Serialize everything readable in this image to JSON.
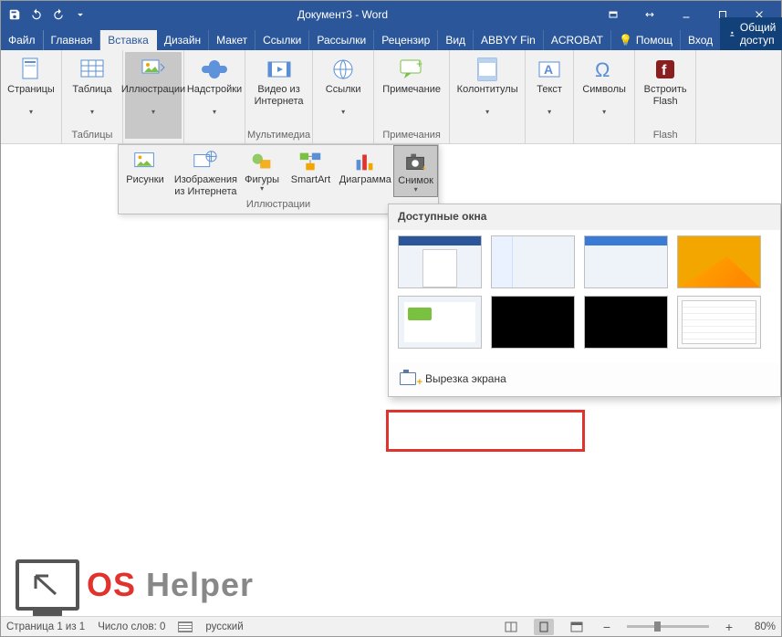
{
  "titlebar": {
    "title": "Документ3 - Word"
  },
  "tabs": {
    "file": "Файл",
    "list": [
      "Главная",
      "Вставка",
      "Дизайн",
      "Макет",
      "Ссылки",
      "Рассылки",
      "Рецензир",
      "Вид",
      "ABBYY Fin",
      "ACROBAT"
    ],
    "active_index": 1,
    "tell_me": "Помощ",
    "sign_in": "Вход",
    "share": "Общий доступ"
  },
  "ribbon": {
    "groups": [
      {
        "name": "pages",
        "caption": "",
        "buttons": [
          {
            "id": "pages",
            "label": "Страницы",
            "drop": true
          }
        ]
      },
      {
        "name": "tables",
        "caption": "Таблицы",
        "buttons": [
          {
            "id": "table",
            "label": "Таблица",
            "drop": true
          }
        ]
      },
      {
        "name": "illustr",
        "caption": "",
        "buttons": [
          {
            "id": "illustrations",
            "label": "Иллюстрации",
            "drop": true,
            "selected": true
          }
        ]
      },
      {
        "name": "addins",
        "caption": "",
        "buttons": [
          {
            "id": "addins",
            "label": "Надстройки",
            "drop": true
          }
        ]
      },
      {
        "name": "media",
        "caption": "Мультимедиа",
        "buttons": [
          {
            "id": "online-video",
            "label": "Видео из Интернета"
          }
        ]
      },
      {
        "name": "links",
        "caption": "",
        "buttons": [
          {
            "id": "links",
            "label": "Ссылки",
            "drop": true
          }
        ]
      },
      {
        "name": "comments",
        "caption": "Примечания",
        "buttons": [
          {
            "id": "comment",
            "label": "Примечание"
          }
        ]
      },
      {
        "name": "headerfooter",
        "caption": "",
        "buttons": [
          {
            "id": "headerfooter",
            "label": "Колонтитулы",
            "drop": true
          }
        ]
      },
      {
        "name": "text",
        "caption": "",
        "buttons": [
          {
            "id": "text",
            "label": "Текст",
            "drop": true
          }
        ]
      },
      {
        "name": "symbols",
        "caption": "",
        "buttons": [
          {
            "id": "symbols",
            "label": "Символы",
            "drop": true
          }
        ]
      },
      {
        "name": "flash",
        "caption": "Flash",
        "buttons": [
          {
            "id": "embed-flash",
            "label": "Встроить Flash"
          }
        ]
      }
    ]
  },
  "illustrations_popout": {
    "caption": "Иллюстрации",
    "buttons": [
      {
        "id": "pictures",
        "label": "Рисунки"
      },
      {
        "id": "online-pictures",
        "label": "Изображения из Интернета"
      },
      {
        "id": "shapes",
        "label": "Фигуры",
        "drop": true
      },
      {
        "id": "smartart",
        "label": "SmartArt"
      },
      {
        "id": "chart",
        "label": "Диаграмма"
      },
      {
        "id": "screenshot",
        "label": "Снимок",
        "drop": true,
        "selected": true
      }
    ]
  },
  "screenshot_panel": {
    "header": "Доступные окна",
    "clip": "Вырезка экрана"
  },
  "statusbar": {
    "page": "Страница 1 из 1",
    "words": "Число слов: 0",
    "language": "русский",
    "zoom": "80%"
  },
  "logo": {
    "part1": "OS",
    "part2": " Helper"
  }
}
